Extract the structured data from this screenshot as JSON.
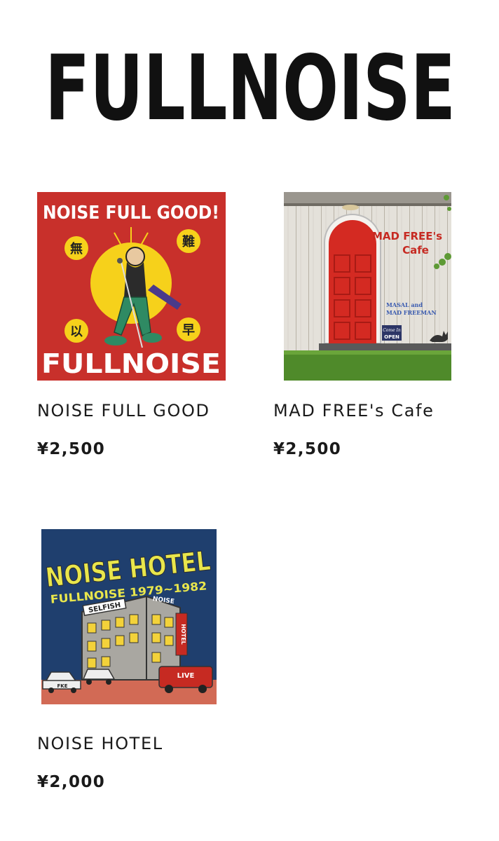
{
  "site": {
    "logo_text": "FULLNOISE"
  },
  "products": [
    {
      "name": "NOISE FULL GOOD",
      "price": "¥2,500",
      "cover": {
        "title_text": "NOISE FULL GOOD!",
        "band_text": "FULLNOISE",
        "kanji": [
          "無",
          "難",
          "以",
          "早"
        ],
        "background": "#c8302b"
      }
    },
    {
      "name": "MAD FREE's Cafe",
      "price": "¥2,500",
      "cover": {
        "title_line1": "MAD FREE's",
        "title_line2": "Cafe",
        "artist_line1": "MASAL and",
        "artist_line2": "MAD FREEMAN",
        "sign_line1": "Come In",
        "sign_line2": "OPEN",
        "door_color": "#d42a22"
      }
    },
    {
      "name": "NOISE HOTEL",
      "price": "¥2,000",
      "cover": {
        "title_text": "NOISE HOTEL",
        "subtitle_text": "FULLNOISE 1979~1982",
        "sign_left": "SELFISH",
        "sign_right": "NOISE",
        "side_sign": "HOTEL",
        "bus_text": "LIVE",
        "car_text": "FKE",
        "background": "#1f3f6e"
      }
    }
  ]
}
